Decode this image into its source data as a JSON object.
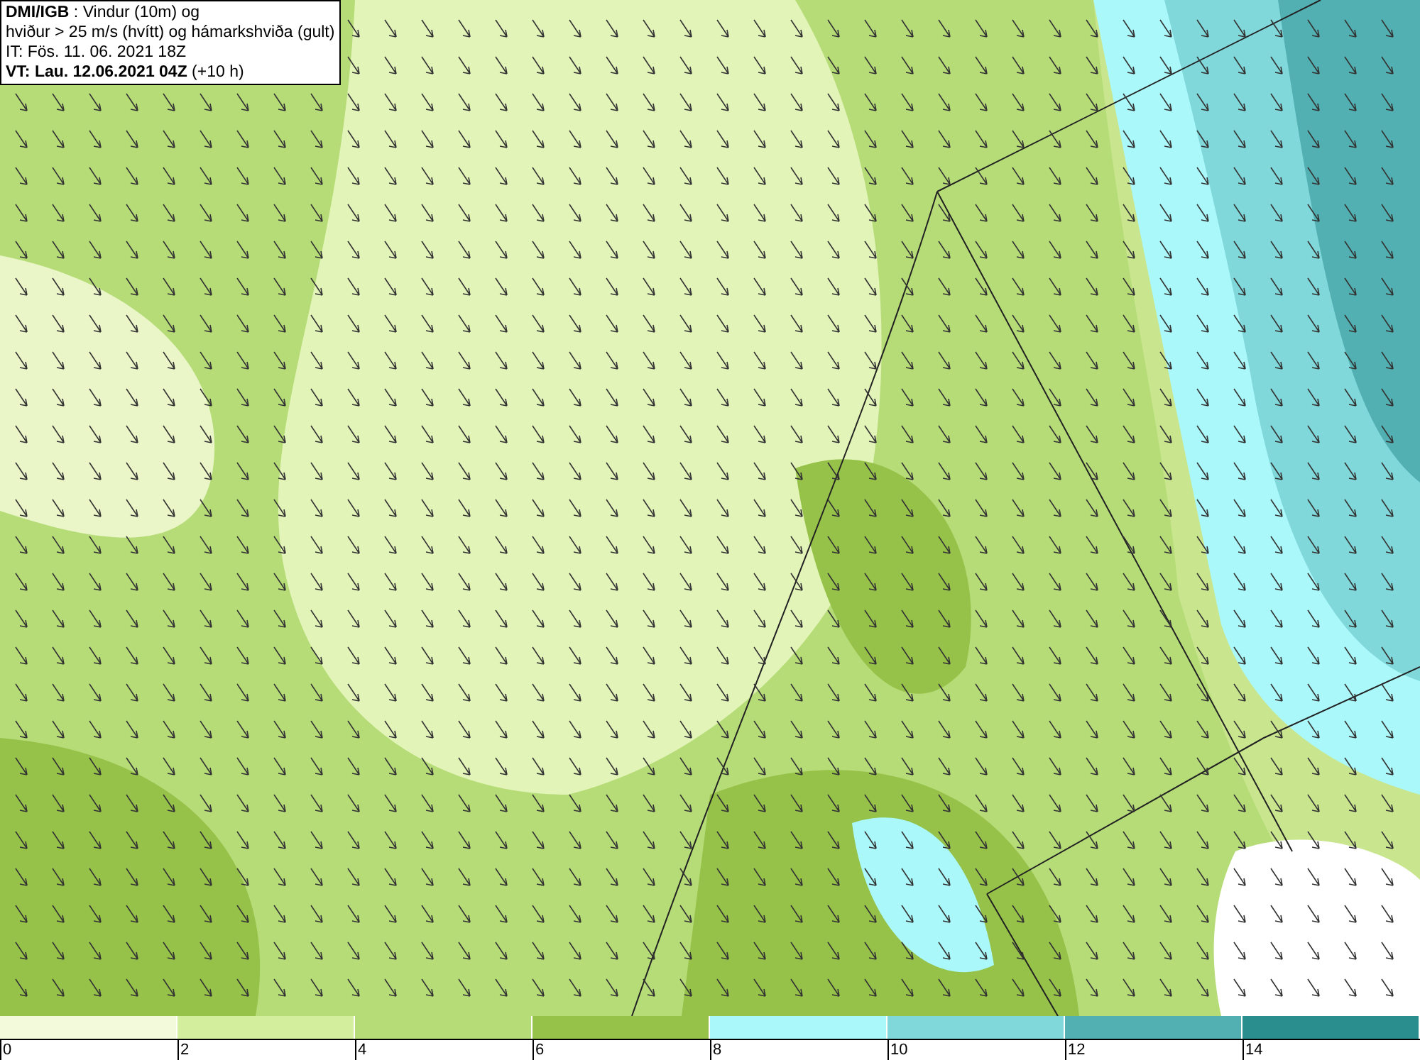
{
  "header": {
    "lines": [
      "**DMI/IGB** : Vindur (10m) og",
      "hviður > 25 m/s (hvítt) og hámarkshviða (gult)",
      "IT: Fös. 11. 06. 2021 18Z",
      "**VT: Lau. 12.06.2021 04Z** (+10 h)"
    ]
  },
  "legend": {
    "segments": [
      {
        "color": "#f3fadc",
        "label": "0"
      },
      {
        "color": "#d3ee9c",
        "label": "2"
      },
      {
        "color": "#b6dc78",
        "label": "4"
      },
      {
        "color": "#96c24a",
        "label": "6"
      },
      {
        "color": "#aaf8fa",
        "label": "8"
      },
      {
        "color": "#80d8da",
        "label": "10"
      },
      {
        "color": "#52b0b2",
        "label": "12"
      },
      {
        "color": "#2a8e8e",
        "label": "14"
      }
    ]
  }
}
